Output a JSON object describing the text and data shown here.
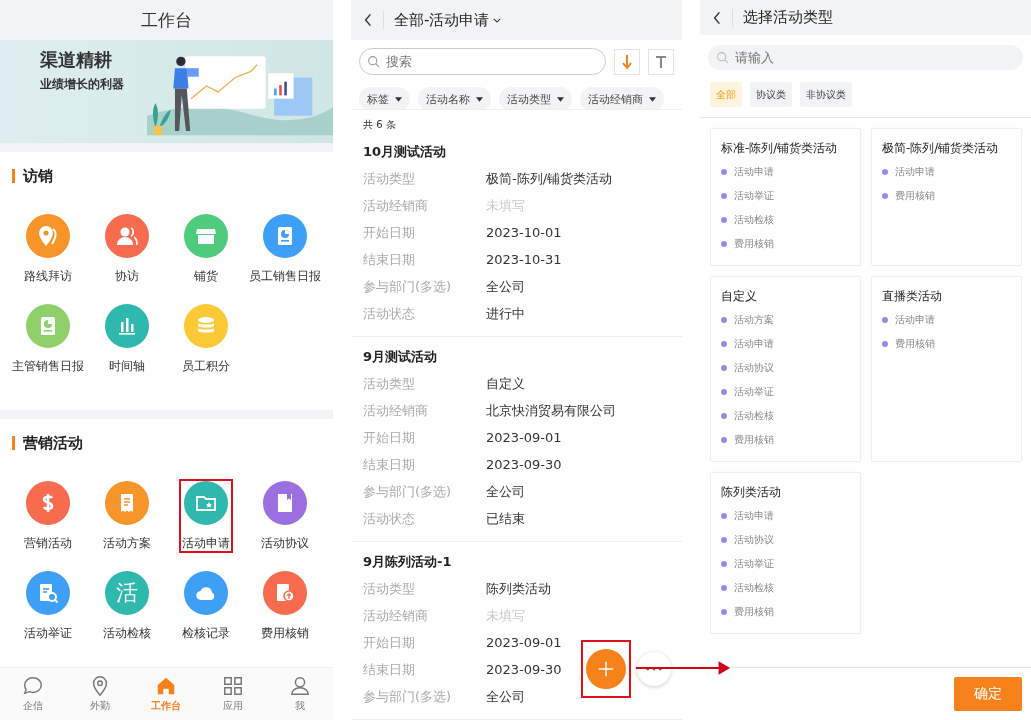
{
  "workbench": {
    "title": "工作台",
    "banner": {
      "headline": "渠道精耕",
      "subline": "业绩增长的利器"
    },
    "sections": [
      {
        "title": "访销",
        "items": [
          {
            "label": "路线拜访",
            "kind": "pin",
            "color": "#f7942a",
            "highlighted": false
          },
          {
            "label": "协访",
            "kind": "people",
            "color": "#f76b4f",
            "highlighted": false
          },
          {
            "label": "铺货",
            "kind": "store",
            "color": "#4fcb7e",
            "highlighted": false
          },
          {
            "label": "员工销售日报",
            "kind": "report",
            "color": "#3d9ff5",
            "highlighted": false
          },
          {
            "label": "主管销售日报",
            "kind": "report",
            "color": "#8fd06a",
            "highlighted": false
          },
          {
            "label": "时间轴",
            "kind": "bars",
            "color": "#2fb8ad",
            "highlighted": false
          },
          {
            "label": "员工积分",
            "kind": "coins",
            "color": "#fbc935",
            "highlighted": false
          }
        ]
      },
      {
        "title": "营销活动",
        "items": [
          {
            "label": "营销活动",
            "kind": "dollar",
            "color": "#f76b4f",
            "highlighted": false
          },
          {
            "label": "活动方案",
            "kind": "doc",
            "color": "#f7942a",
            "highlighted": false
          },
          {
            "label": "活动申请",
            "kind": "folder",
            "color": "#2fb8ad",
            "highlighted": true
          },
          {
            "label": "活动协议",
            "kind": "book",
            "color": "#9b6fe0",
            "highlighted": false
          },
          {
            "label": "活动举证",
            "kind": "search-doc",
            "color": "#3d9ff5",
            "highlighted": false
          },
          {
            "label": "活动检核",
            "kind": "char",
            "glyph": "活",
            "color": "#2fb8ad",
            "highlighted": false
          },
          {
            "label": "检核记录",
            "kind": "cloud",
            "color": "#3d9ff5",
            "highlighted": false
          },
          {
            "label": "费用核销",
            "kind": "receipt",
            "color": "#f76b4f",
            "highlighted": false
          }
        ]
      }
    ],
    "bottom_nav": [
      {
        "label": "企信",
        "kind": "chat",
        "selected": false
      },
      {
        "label": "外勤",
        "kind": "pin",
        "selected": false
      },
      {
        "label": "工作台",
        "kind": "home",
        "selected": true
      },
      {
        "label": "应用",
        "kind": "grid",
        "selected": false
      },
      {
        "label": "我",
        "kind": "person",
        "selected": false
      }
    ]
  },
  "activity_list": {
    "title": "全部-活动申请",
    "search": {
      "placeholder": "搜索"
    },
    "chips": [
      "标签",
      "活动名称",
      "活动类型",
      "活动经销商"
    ],
    "count": "共 6 条",
    "records": [
      {
        "title": "10月测试活动",
        "fields": [
          {
            "label": "活动类型",
            "value": "极简-陈列/铺货类活动",
            "empty": false
          },
          {
            "label": "活动经销商",
            "value": "未填写",
            "empty": true
          },
          {
            "label": "开始日期",
            "value": "2023-10-01",
            "empty": false
          },
          {
            "label": "结束日期",
            "value": "2023-10-31",
            "empty": false
          },
          {
            "label": "参与部门(多选)",
            "value": "全公司",
            "empty": false
          },
          {
            "label": "活动状态",
            "value": "进行中",
            "empty": false
          }
        ]
      },
      {
        "title": "9月测试活动",
        "fields": [
          {
            "label": "活动类型",
            "value": "自定义",
            "empty": false
          },
          {
            "label": "活动经销商",
            "value": "北京快消贸易有限公司",
            "empty": false
          },
          {
            "label": "开始日期",
            "value": "2023-09-01",
            "empty": false
          },
          {
            "label": "结束日期",
            "value": "2023-09-30",
            "empty": false
          },
          {
            "label": "参与部门(多选)",
            "value": "全公司",
            "empty": false
          },
          {
            "label": "活动状态",
            "value": "已结束",
            "empty": false
          }
        ]
      },
      {
        "title": "9月陈列活动-1",
        "fields": [
          {
            "label": "活动类型",
            "value": "陈列类活动",
            "empty": false
          },
          {
            "label": "活动经销商",
            "value": "未填写",
            "empty": true
          },
          {
            "label": "开始日期",
            "value": "2023-09-01",
            "empty": false
          },
          {
            "label": "结束日期",
            "value": "2023-09-30",
            "empty": false
          },
          {
            "label": "参与部门(多选)",
            "value": "全公司",
            "empty": false
          }
        ]
      }
    ],
    "add_button": {
      "highlighted": true
    }
  },
  "type_picker": {
    "title": "选择活动类型",
    "search": {
      "placeholder": "请输入"
    },
    "tabs": [
      {
        "label": "全部",
        "selected": true
      },
      {
        "label": "协议类",
        "selected": false
      },
      {
        "label": "非协议类",
        "selected": false
      }
    ],
    "types": [
      {
        "name": "标准-陈列/铺货类活动",
        "steps": [
          "活动申请",
          "活动举证",
          "活动检核",
          "费用核销"
        ]
      },
      {
        "name": "极简-陈列/铺货类活动",
        "steps": [
          "活动申请",
          "费用核销"
        ]
      },
      {
        "name": "自定义",
        "steps": [
          "活动方案",
          "活动申请",
          "活动协议",
          "活动举证",
          "活动检核",
          "费用核销"
        ]
      },
      {
        "name": "直播类活动",
        "steps": [
          "活动申请",
          "费用核销"
        ]
      },
      {
        "name": "陈列类活动",
        "steps": [
          "活动申请",
          "活动协议",
          "活动举证",
          "活动检核",
          "费用核销"
        ]
      }
    ],
    "confirm": "确定"
  }
}
